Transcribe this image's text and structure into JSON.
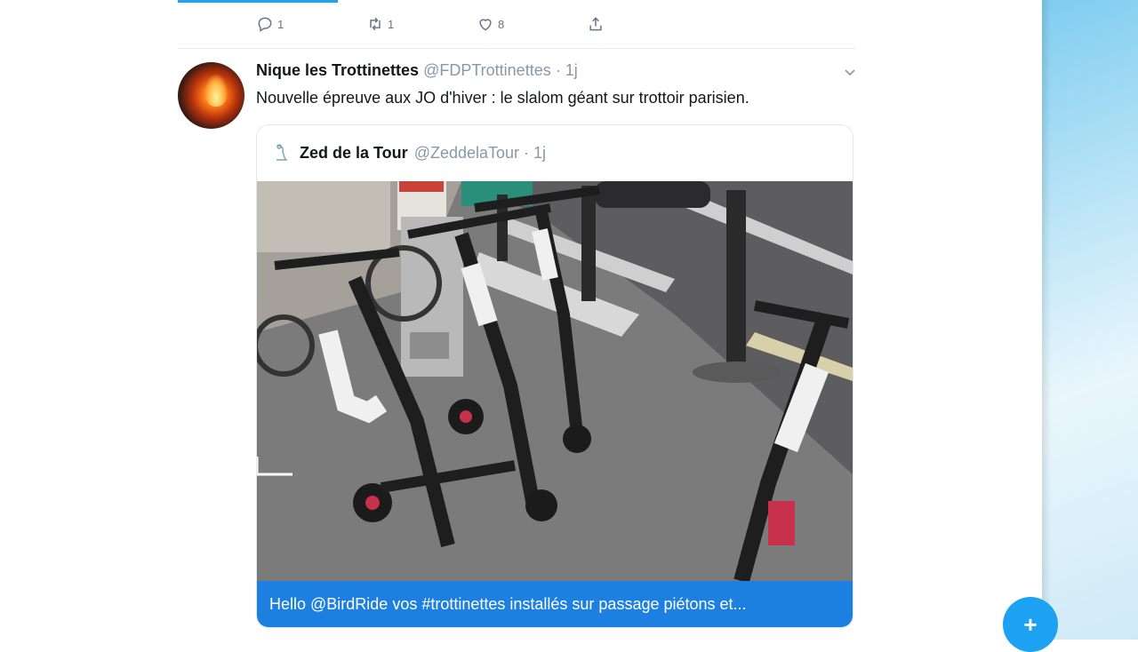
{
  "previous_tweet": {
    "reply_count": "1",
    "retweet_count": "1",
    "like_count": "8"
  },
  "tweet": {
    "name": "Nique les Trottinettes",
    "handle": "@FDPTrottinettes",
    "separator": "·",
    "time": "1j",
    "text": "Nouvelle épreuve aux JO d'hiver : le slalom géant sur trottoir parisien.",
    "quoted": {
      "name": "Zed de la Tour",
      "handle": "@ZeddelaTour",
      "separator": "·",
      "time": "1j",
      "caption": "Hello @BirdRide vos #trottinettes installés sur passage piétons et..."
    }
  },
  "compose_label": "+",
  "colors": {
    "accent": "#1da1f2",
    "caption_bg": "#1d7fe0",
    "muted": "#8899a6"
  },
  "icons": [
    "reply-icon",
    "retweet-icon",
    "like-icon",
    "share-icon",
    "chevron-down-icon",
    "compose-icon"
  ]
}
